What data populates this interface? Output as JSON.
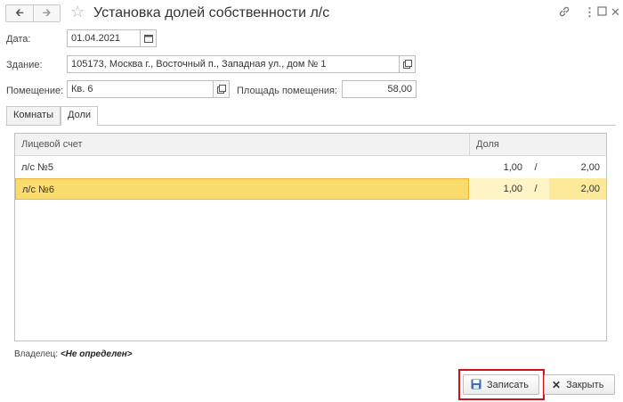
{
  "header": {
    "title": "Установка долей собственности л/с",
    "back_icon": "arrow-left-icon",
    "forward_icon": "arrow-right-icon",
    "favorite_icon": "star-icon",
    "link_icon": "link-icon",
    "menu_icon": "more-vertical-icon",
    "maximize_icon": "maximize-icon",
    "close_icon": "close-icon"
  },
  "form": {
    "date_label": "Дата:",
    "date_value": "01.04.2021",
    "building_label": "Здание:",
    "building_value": "105173, Москва г., Восточный п., Западная ул., дом № 1",
    "room_label": "Помещение:",
    "room_value": "Кв. 6",
    "area_label": "Площадь помещения:",
    "area_value": "58,00"
  },
  "tabs": [
    {
      "label": "Комнаты",
      "active": false
    },
    {
      "label": "Доли",
      "active": true
    }
  ],
  "table": {
    "columns": [
      "Лицевой счет",
      "Доля"
    ],
    "rows": [
      {
        "account": "л/с №5",
        "numerator": "1,00",
        "slash": "/",
        "denominator": "2,00",
        "selected": false
      },
      {
        "account": "л/с №6",
        "numerator": "1,00",
        "slash": "/",
        "denominator": "2,00",
        "selected": true
      }
    ]
  },
  "owner": {
    "label": "Владелец:",
    "value": "<Не определен>"
  },
  "footer": {
    "save_label": "Записать",
    "close_label": "Закрыть"
  },
  "colors": {
    "selection_row": "#fff4c6",
    "selection_cell": "#fadc6e",
    "highlight_border": "#d0111b"
  }
}
